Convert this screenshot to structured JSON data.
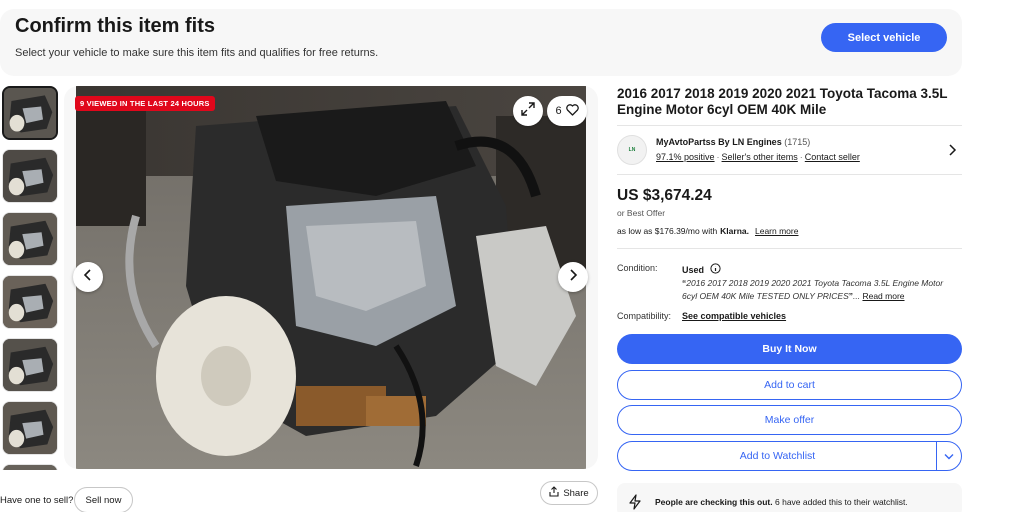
{
  "fitment": {
    "title": "Confirm this item fits",
    "subtitle": "Select your vehicle to make sure this item fits and qualifies for free returns.",
    "button": "Select vehicle"
  },
  "gallery": {
    "thumbnails": [
      {
        "name": "engine photo 1",
        "selected": true
      },
      {
        "name": "engine photo 2",
        "selected": false
      },
      {
        "name": "engine photo 3",
        "selected": false
      },
      {
        "name": "engine photo 4",
        "selected": false
      },
      {
        "name": "engine photo 5",
        "selected": false
      },
      {
        "name": "engine photo 6",
        "selected": false
      },
      {
        "name": "engine photo 7",
        "selected": false
      }
    ],
    "viewed_badge": "9 VIEWED IN THE LAST 24 HOURS",
    "watch_count": "6",
    "icons": {
      "expand": "expand-icon",
      "heart": "heart-icon",
      "prev": "chevron-left-icon",
      "next": "chevron-right-icon"
    }
  },
  "sell": {
    "prompt": "Have one to sell?",
    "button": "Sell now"
  },
  "share": {
    "label": "Share"
  },
  "item": {
    "title": "2016 2017 2018 2019 2020 2021 Toyota Tacoma 3.5L Engine Motor 6cyl OEM 40K Mile"
  },
  "seller": {
    "logo_text": "LN",
    "name": "MyAvtoPartss By LN Engines",
    "feedback_count": "(1715)",
    "positive": "97.1% positive",
    "other_items": "Seller's other items",
    "contact": "Contact seller"
  },
  "pricing": {
    "price": "US $3,674.24",
    "best_offer": "or Best Offer",
    "klarna_prefix": "as low as $176.39/mo with",
    "klarna_brand": "Klarna.",
    "klarna_link": "Learn more"
  },
  "condition": {
    "label": "Condition:",
    "value": "Used",
    "description": "2016 2017 2018 2019 2020 2021 Toyota Tacoma 3.5L Engine Motor 6cyl OEM 40K Mile TESTED ONLY PRICES",
    "read_more": "Read more"
  },
  "compatibility": {
    "label": "Compatibility:",
    "link": "See compatible vehicles"
  },
  "actions": {
    "buy_now": "Buy It Now",
    "add_to_cart": "Add to cart",
    "make_offer": "Make offer",
    "add_to_watchlist": "Add to Watchlist"
  },
  "social_proof": {
    "headline": "People are checking this out.",
    "detail": "6 have added this to their watchlist."
  },
  "colors": {
    "primary": "#3665f3",
    "badge_red": "#e0071b",
    "banner_bg": "#f7f7f7"
  }
}
